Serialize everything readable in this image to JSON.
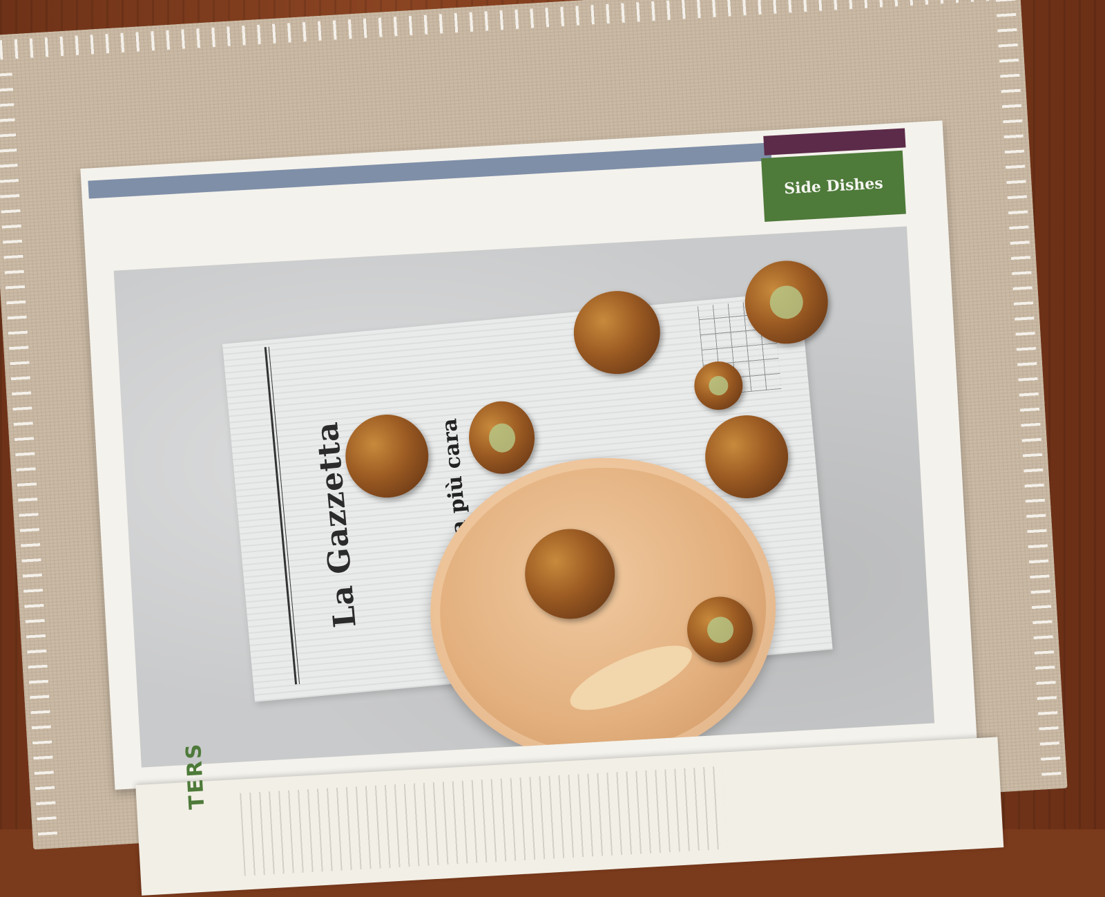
{
  "book": {
    "section_tab": "Side Dishes",
    "left_page_heading": "TERS"
  },
  "photo": {
    "newspaper_title": "La Gazzetta",
    "newspaper_headline": "Mosca più cara"
  },
  "colors": {
    "tab": "#4e7a3a",
    "header_bar": "#7f8fa8",
    "header_accent": "#5c2b49",
    "plate": "#e3b07e",
    "wood": "#7a3a1c",
    "mat": "#cbbba6"
  }
}
